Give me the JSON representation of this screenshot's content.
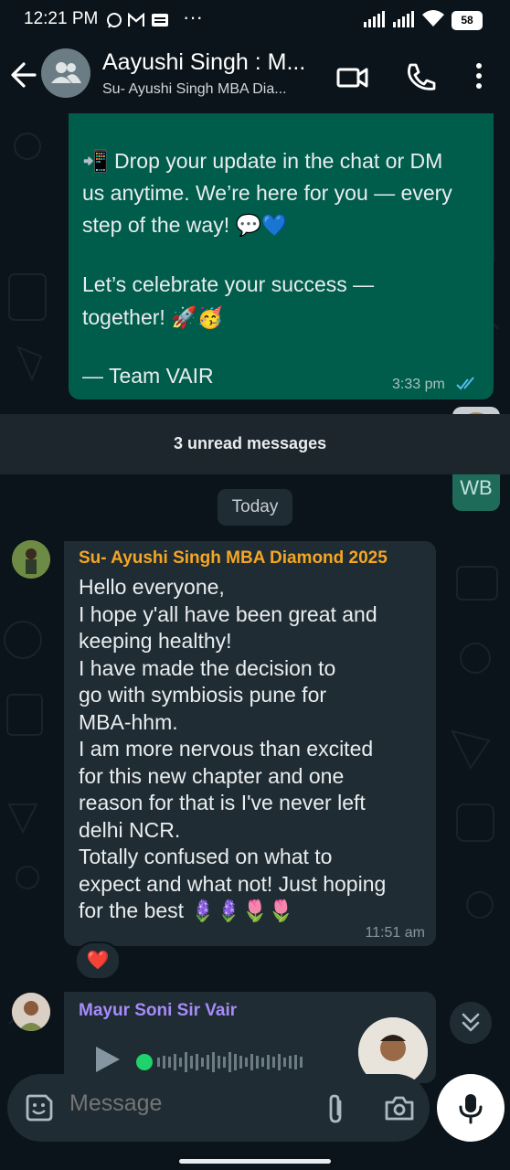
{
  "status_bar": {
    "time": "12:21 PM",
    "icons": [
      "whatsapp-icon",
      "gmail-icon",
      "news-icon",
      "more-dots"
    ],
    "battery": "58"
  },
  "header": {
    "title": "Aayushi Singh : M...",
    "subtitle": "Su- Ayushi Singh MBA Dia...",
    "icons": [
      "back-arrow-icon",
      "group-avatar-icon",
      "video-call-icon",
      "voice-call-icon",
      "overflow-menu-icon"
    ]
  },
  "outgoing_message": {
    "lines": [
      "📲 Drop your update in the chat or DM",
      "us anytime. We’re here for you — every",
      "step of the way! 💬💙",
      "",
      "Let’s celebrate your success —",
      "together! 🚀🥳",
      "",
      "— Team VAIR"
    ],
    "time": "3:33 pm",
    "status": "read"
  },
  "unread_banner": "3 unread messages",
  "day_chip": "Today",
  "side_buttons": [
    "accessibility-icon",
    "WB"
  ],
  "message1": {
    "sender": "Su- Ayushi Singh MBA Diamond 2025",
    "sender_color": "#f5a623",
    "lines": [
      "Hello everyone,",
      "I hope y'all have been great and",
      "keeping healthy!",
      "I have made the decision to",
      "go with symbiosis pune for",
      "MBA-hhm.",
      "I am more nervous than excited",
      "for this new chapter and one",
      "reason for that is I've never left",
      "delhi NCR.",
      "Totally confused on what to",
      "expect and what not! Just hoping",
      "for the best 🪻🪻🌷🌷"
    ],
    "time": "11:51 am",
    "reaction": "❤️"
  },
  "message2": {
    "sender": "Mayur Soni Sir Vair",
    "sender_color": "#a78bfa",
    "type": "voice-note"
  },
  "composer": {
    "placeholder": "Message",
    "icons": [
      "emoji-sticker-icon",
      "attach-clip-icon",
      "camera-icon",
      "microphone-icon"
    ]
  }
}
